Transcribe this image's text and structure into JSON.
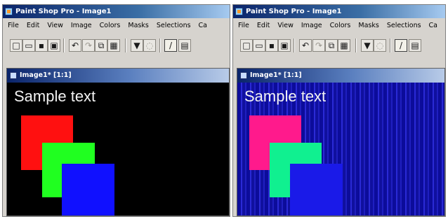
{
  "app": {
    "title": "Paint Shop Pro - Image1",
    "menu": [
      "File",
      "Edit",
      "View",
      "Image",
      "Colors",
      "Masks",
      "Selections",
      "Ca"
    ]
  },
  "panels": [
    {
      "id": "left",
      "document_title": "Image1* [1:1]",
      "sample_text": "Sample text",
      "colors": {
        "background": "#000000",
        "square_1": "#ff1010",
        "square_2": "#20ff20",
        "square_3": "#1010ff"
      }
    },
    {
      "id": "right",
      "document_title": "Image1* [1:1]",
      "sample_text": "Sample text",
      "colors": {
        "background": "#0a0a9c",
        "square_1": "#ff1a8c",
        "square_2": "#10f090",
        "square_3": "#1a1ae8"
      }
    }
  ],
  "toolbar_icons": [
    "new-file-icon",
    "open-file-icon",
    "save-icon",
    "print-icon",
    "undo-icon",
    "redo-icon",
    "copy-icon",
    "paste-icon",
    "browse-icon",
    "zoom-icon",
    "paintbrush-icon",
    "dropper-icon"
  ],
  "toolbar_glyphs": [
    "□",
    "▭",
    "▪",
    "▣",
    "↶",
    "↷",
    "⧉",
    "▦",
    "▼",
    "◌",
    "/",
    "▤"
  ]
}
